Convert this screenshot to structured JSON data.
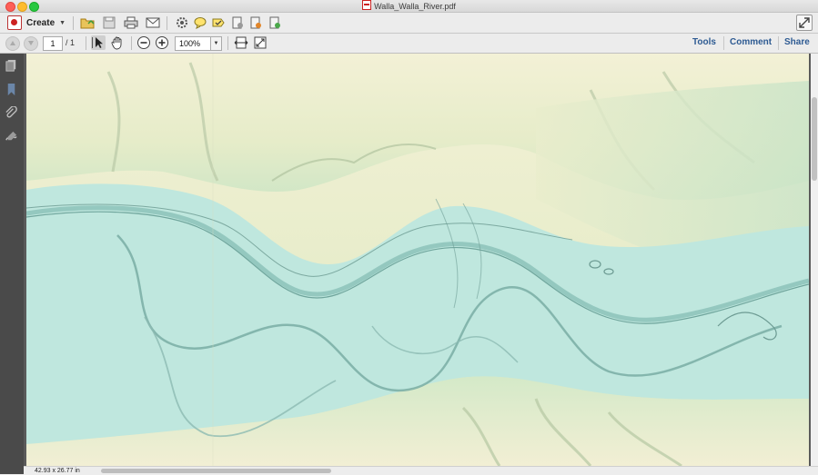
{
  "window": {
    "title": "Walla_Walla_River.pdf"
  },
  "toolbar": {
    "create_label": "Create",
    "icons": [
      "open-folder-icon",
      "save-icon",
      "print-icon",
      "email-icon",
      "gear-icon",
      "comment-icon",
      "sign-icon",
      "stamp-icon",
      "export-icon",
      "share-file-icon"
    ]
  },
  "nav": {
    "current_page": "1",
    "page_total": "/ 1",
    "zoom": "100%"
  },
  "right_tabs": {
    "tools": "Tools",
    "comment": "Comment",
    "share": "Share"
  },
  "status": {
    "page_size": "42.93 x 26.77 in"
  },
  "colors": {
    "accent": "#2d5a92",
    "river": "#b9e6dd",
    "terrain_high": "#f1f0d6",
    "terrain_green": "#cfe6c3"
  }
}
